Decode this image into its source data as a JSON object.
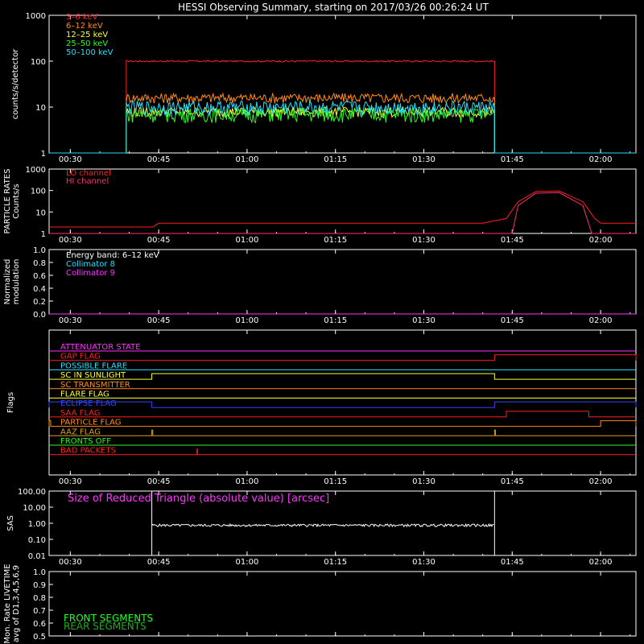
{
  "title": "HESSI Observing Summary, starting on 2017/03/26 00:26:24 UT",
  "time_ticks": [
    "00:30",
    "00:45",
    "01:00",
    "01:15",
    "01:30",
    "01:45",
    "02:00"
  ],
  "chart_data": [
    {
      "type": "line",
      "panel": "counts",
      "ylabel": "counts/s/detector",
      "yscale": "log",
      "ylim": [
        1,
        1000
      ],
      "ytick_labels": [
        "1",
        "10",
        "100",
        "1000"
      ],
      "xlim": [
        "00:26:24",
        "02:06:00"
      ],
      "series": [
        {
          "name": "3–6 keV",
          "color": "#ff2020",
          "segments": [
            {
              "start": "00:39:30",
              "end": "01:42:00",
              "level": 100
            }
          ]
        },
        {
          "name": "6–12 keV",
          "color": "#ff8c1a",
          "segments": [
            {
              "start": "00:39:30",
              "end": "01:42:00",
              "level": 16
            }
          ]
        },
        {
          "name": "12–25 keV",
          "color": "#ffff33",
          "segments": [
            {
              "start": "00:39:30",
              "end": "01:42:00",
              "level": 8
            }
          ]
        },
        {
          "name": "25–50 keV",
          "color": "#22ff22",
          "segments": [
            {
              "start": "00:39:30",
              "end": "01:42:00",
              "level": 7
            }
          ]
        },
        {
          "name": "50–100 keV",
          "color": "#22e0ff",
          "segments": [
            {
              "start": "00:39:30",
              "end": "01:42:00",
              "level": 10
            }
          ]
        }
      ]
    },
    {
      "type": "line",
      "panel": "particle",
      "ylabel": "PARTICLE RATES\nCounts/s",
      "yscale": "log",
      "ylim": [
        1,
        1000
      ],
      "ytick_labels": [
        "1",
        "10",
        "100",
        "1000"
      ],
      "series": [
        {
          "name": "LO channel",
          "color": "#ff2020",
          "points": [
            [
              "00:26:24",
              2
            ],
            [
              "00:44:00",
              2
            ],
            [
              "00:45:00",
              3
            ],
            [
              "01:40:00",
              3
            ],
            [
              "01:44:00",
              5
            ],
            [
              "01:46:00",
              30
            ],
            [
              "01:49:00",
              90
            ],
            [
              "01:53:00",
              95
            ],
            [
              "01:57:00",
              30
            ],
            [
              "01:59:00",
              5
            ],
            [
              "02:00:00",
              3
            ],
            [
              "02:06:00",
              3
            ]
          ]
        },
        {
          "name": "HI channel",
          "color": "#ff3070",
          "points": [
            [
              "00:26:24",
              1
            ],
            [
              "01:45:00",
              1
            ],
            [
              "01:46:00",
              20
            ],
            [
              "01:49:00",
              75
            ],
            [
              "01:53:00",
              80
            ],
            [
              "01:57:00",
              20
            ],
            [
              "01:58:30",
              1
            ],
            [
              "02:06:00",
              1
            ]
          ]
        }
      ]
    },
    {
      "type": "line",
      "panel": "modulation",
      "ylabel": "Normalized\nmodulation",
      "ylim": [
        0,
        1
      ],
      "ytick_labels": [
        "0.0",
        "0.2",
        "0.4",
        "0.6",
        "0.8",
        "1.0"
      ],
      "annotation": "Energy band: 6–12 keV",
      "series": [
        {
          "name": "Collimator 8",
          "color": "#22e0ff",
          "points": []
        },
        {
          "name": "Collimator 9",
          "color": "#ff33ff",
          "points": [
            [
              "00:26:24",
              0
            ],
            [
              "02:06:00",
              0
            ]
          ]
        }
      ]
    },
    {
      "type": "line",
      "panel": "flags",
      "ylabel": "Flags",
      "series": [
        {
          "name": "ATTENUATOR STATE",
          "color": "#ff33ff",
          "segments": []
        },
        {
          "name": "GAP FLAG",
          "color": "#ff2020",
          "segments": [
            [
              "01:42:00",
              "02:06:00"
            ]
          ]
        },
        {
          "name": "POSSIBLE FLARE",
          "color": "#22e0ff",
          "segments": []
        },
        {
          "name": "SC IN SUNLIGHT",
          "color": "#ffff33",
          "segments": [
            [
              "00:43:50",
              "01:42:00"
            ]
          ]
        },
        {
          "name": "SC TRANSMITTER",
          "color": "#ff8c1a",
          "segments": []
        },
        {
          "name": "FLARE FLAG",
          "color": "#ffff33",
          "segments": []
        },
        {
          "name": "ECLIPSE FLAG",
          "color": "#3344ff",
          "segments": [
            [
              "00:26:24",
              "00:43:50"
            ],
            [
              "01:42:00",
              "02:06:00"
            ]
          ]
        },
        {
          "name": "SAA FLAG",
          "color": "#ff2020",
          "segments": [
            [
              "01:44:00",
              "01:58:00"
            ]
          ]
        },
        {
          "name": "PARTICLE FLAG",
          "color": "#ff8c1a",
          "segments": [
            [
              "00:26:24",
              "00:26:40"
            ],
            [
              "02:00:00",
              "02:06:00"
            ]
          ]
        },
        {
          "name": "AAZ FLAG",
          "color": "#d8a020",
          "segments": [
            [
              "00:43:50",
              "00:44:00"
            ],
            [
              "01:42:00",
              "01:42:10"
            ]
          ]
        },
        {
          "name": "FRONTS OFF",
          "color": "#22ff22",
          "segments": []
        },
        {
          "name": "BAD PACKETS",
          "color": "#ff2020",
          "segments": [
            [
              "00:51:30",
              "00:51:35"
            ]
          ]
        }
      ]
    },
    {
      "type": "line",
      "panel": "sas",
      "ylabel": "SAS",
      "yscale": "log",
      "ylim": [
        0.01,
        100
      ],
      "ytick_labels": [
        "0.01",
        "0.10",
        "1.00",
        "10.00",
        "100.00"
      ],
      "annotation": "Size of Reduced Triangle (absolute value) [arcsec]",
      "series": [
        {
          "name": "",
          "color": "#ffffff",
          "segments": [
            {
              "start": "00:43:50",
              "end": "01:42:00",
              "level": 0.75
            }
          ]
        }
      ]
    },
    {
      "type": "line",
      "panel": "livetime",
      "ylabel": "Mon. Rate LIVETIME\navg of D1,3,4,5,6,9",
      "ylim": [
        0.5,
        1.0
      ],
      "ytick_labels": [
        "0.5",
        "0.6",
        "0.7",
        "0.8",
        "0.9",
        "1.0"
      ],
      "series": [
        {
          "name": "FRONT SEGMENTS",
          "color": "#22ff22",
          "points": []
        },
        {
          "name": "REAR SEGMENTS",
          "color": "#22aa22",
          "points": []
        }
      ]
    }
  ]
}
